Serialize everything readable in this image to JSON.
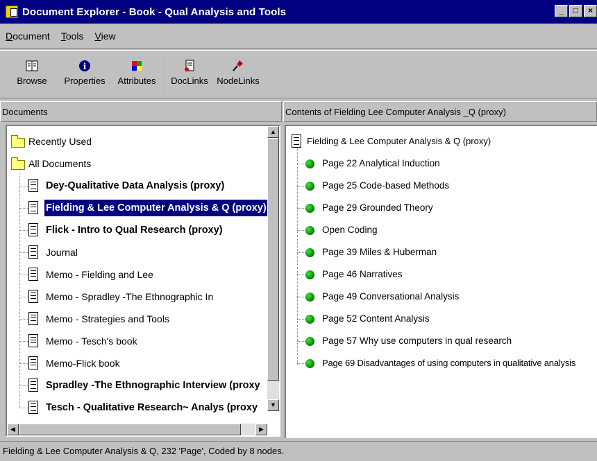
{
  "window": {
    "title": "Document Explorer - Book - Qual Analysis and Tools",
    "controls": [
      "minimize",
      "maximize",
      "close"
    ]
  },
  "menu": [
    {
      "label": "Document",
      "underline": "D",
      "rest": "ocument"
    },
    {
      "label": "Tools",
      "underline": "T",
      "rest": "ools"
    },
    {
      "label": "View",
      "underline": "V",
      "rest": "iew"
    }
  ],
  "toolbar": {
    "buttons": [
      {
        "label": "Browse",
        "icon": "book-icon"
      },
      {
        "label": "Properties",
        "icon": "info-icon"
      },
      {
        "label": "Attributes",
        "icon": "attributes-grid-icon"
      },
      {
        "label": "DocLinks",
        "icon": "doclink-icon"
      },
      {
        "label": "NodeLinks",
        "icon": "nodelink-pin-icon"
      }
    ]
  },
  "left_pane": {
    "header": "Documents",
    "tree": [
      {
        "label": "Recently Used",
        "type": "folder",
        "bold": false,
        "selected": false
      },
      {
        "label": "All Documents",
        "type": "folder",
        "bold": false,
        "selected": false
      },
      {
        "label": "Dey-Qualitative Data Analysis (proxy)",
        "type": "doc",
        "bold": true,
        "selected": false
      },
      {
        "label": "Fielding & Lee Computer Analysis & Q (proxy)",
        "type": "doc",
        "bold": true,
        "selected": true
      },
      {
        "label": "Flick - Intro to Qual Research (proxy)",
        "type": "doc",
        "bold": true,
        "selected": false
      },
      {
        "label": "Journal",
        "type": "doc",
        "bold": false,
        "selected": false
      },
      {
        "label": "Memo - Fielding and Lee",
        "type": "memo",
        "bold": false,
        "selected": false
      },
      {
        "label": "Memo - Spradley -The Ethnographic In",
        "type": "memo",
        "bold": false,
        "selected": false
      },
      {
        "label": "Memo - Strategies and Tools",
        "type": "memo",
        "bold": false,
        "selected": false
      },
      {
        "label": "Memo - Tesch's book",
        "type": "memo",
        "bold": false,
        "selected": false
      },
      {
        "label": "Memo-Flick book",
        "type": "memo",
        "bold": false,
        "selected": false
      },
      {
        "label": "Spradley -The Ethnographic Interview (proxy",
        "type": "doc",
        "bold": true,
        "selected": false
      },
      {
        "label": "Tesch - Qualitative Research~ Analys (proxy",
        "type": "doc",
        "bold": true,
        "selected": false
      }
    ]
  },
  "right_pane": {
    "header": "Contents of Fielding  Lee Computer Analysis _Q (proxy)",
    "root": "Fielding & Lee Computer Analysis & Q (proxy)",
    "nodes": [
      "Page 22 Analytical Induction",
      "Page 25  Code-based Methods",
      "Page 29  Grounded Theory",
      "Open Coding",
      "Page 39  Miles & Huberman",
      "Page 46  Narratives",
      "Page 49  Conversational Analysis",
      "Page 52  Content Analysis",
      "Page 57 Why use computers in qual research",
      "Page 69 Disadvantages of using computers in qualitative analysis"
    ]
  },
  "status": "Fielding & Lee Computer Analysis & Q, 232 'Page', Coded by 8 nodes."
}
